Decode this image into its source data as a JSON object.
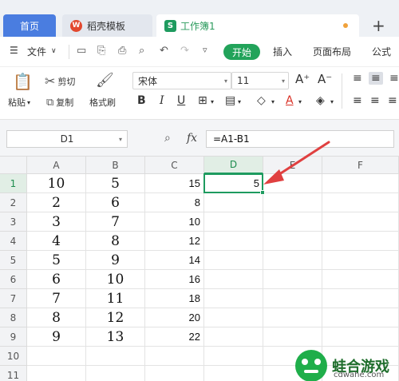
{
  "tabs": {
    "home": "首页",
    "template": "稻壳模板",
    "workbook": "工作簿1",
    "add": "+"
  },
  "menu": {
    "file": "文件",
    "start": "开始",
    "insert": "插入",
    "page_layout": "页面布局",
    "formulas": "公式"
  },
  "ribbon": {
    "paste": "粘贴",
    "cut": "剪切",
    "copy": "复制",
    "format_painter": "格式刷",
    "font_name": "宋体",
    "font_size": "11",
    "bold": "B",
    "italic": "I",
    "underline": "U",
    "grow": "A⁺",
    "shrink": "A⁻"
  },
  "formula_bar": {
    "name_box": "D1",
    "fx": "fx",
    "formula": "=A1-B1"
  },
  "sheet": {
    "columns": [
      "A",
      "B",
      "C",
      "D",
      "E",
      "F"
    ],
    "rows": [
      "1",
      "2",
      "3",
      "4",
      "5",
      "6",
      "7",
      "8",
      "9",
      "10",
      "11"
    ],
    "col_a": [
      "10",
      "2",
      "3",
      "4",
      "5",
      "6",
      "7",
      "8",
      "9"
    ],
    "col_b": [
      "5",
      "6",
      "7",
      "8",
      "9",
      "10",
      "11",
      "12",
      "13"
    ],
    "col_c": [
      "15",
      "8",
      "10",
      "12",
      "14",
      "16",
      "18",
      "20",
      "22"
    ],
    "d1": "5",
    "selected_cell": "D1"
  },
  "watermark": {
    "title": "蛙合游戏",
    "url": "cdwahe.com"
  },
  "colors": {
    "accent_green": "#1e9b5f",
    "home_tab_blue": "#4a7de0",
    "arrow_red": "#e04040"
  }
}
